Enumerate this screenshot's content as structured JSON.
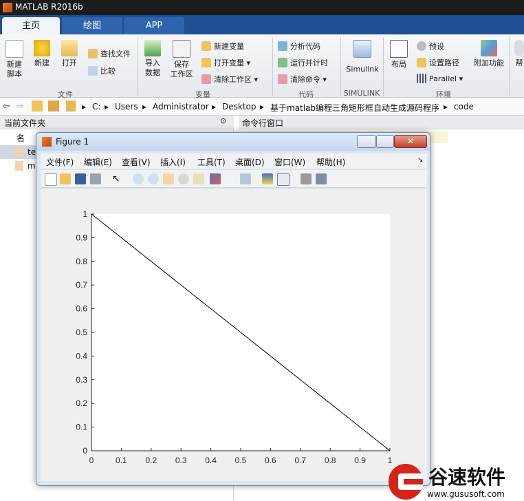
{
  "app": {
    "title": "MATLAB R2016b"
  },
  "tabs": [
    "主页",
    "绘图",
    "APP"
  ],
  "ribbon": {
    "file_group": {
      "label": "文件",
      "new_script": "新建\n脚本",
      "new": "新建",
      "open": "打开",
      "find_files": "查找文件",
      "compare": "比较"
    },
    "variable_group": {
      "label": "变量",
      "import": "导入\n数据",
      "save_ws": "保存\n工作区",
      "new_var": "新建变量",
      "open_var": "打开变量",
      "clear_ws": "清除工作区"
    },
    "code_group": {
      "label": "代码",
      "analyze": "分析代码",
      "run_time": "运行并计时",
      "clear_cmd": "清除命令"
    },
    "simulink_group": {
      "label": "SIMULINK",
      "simulink": "Simulink"
    },
    "env_group": {
      "label": "环境",
      "layout": "布局",
      "prefs": "预设",
      "set_path": "设置路径",
      "parallel": "Parallel",
      "addons": "附加功能"
    },
    "help_partial": "帮"
  },
  "path": [
    "C:",
    "Users",
    "Administrator",
    "Desktop",
    "基于matlab编程三角矩形框自动生成源码程序",
    "code"
  ],
  "panels": {
    "current_folder": "当前文件夹",
    "command_window": "命令行窗口",
    "files_partial": [
      "名",
      "te",
      "m"
    ]
  },
  "figure": {
    "title": "Figure 1",
    "menus": [
      "文件(F)",
      "编辑(E)",
      "查看(V)",
      "插入(I)",
      "工具(T)",
      "桌面(D)",
      "窗口(W)",
      "帮助(H)"
    ]
  },
  "chart_data": {
    "type": "line",
    "x": [
      0,
      1
    ],
    "y": [
      1,
      0
    ],
    "xlim": [
      0,
      1
    ],
    "ylim": [
      0,
      1
    ],
    "xticks": [
      "0",
      "0.1",
      "0.2",
      "0.3",
      "0.4",
      "0.5",
      "0.6",
      "0.7",
      "0.8",
      "0.9",
      "1"
    ],
    "yticks": [
      "0",
      "0.1",
      "0.2",
      "0.3",
      "0.4",
      "0.5",
      "0.6",
      "0.7",
      "0.8",
      "0.9",
      "1"
    ],
    "grid": false,
    "line_color": "#000000"
  },
  "watermark": {
    "name": "谷速软件",
    "url": "www.gususoft.com"
  },
  "colors": {
    "accent": "#1e4f93",
    "watermark_red": "#d62418"
  }
}
